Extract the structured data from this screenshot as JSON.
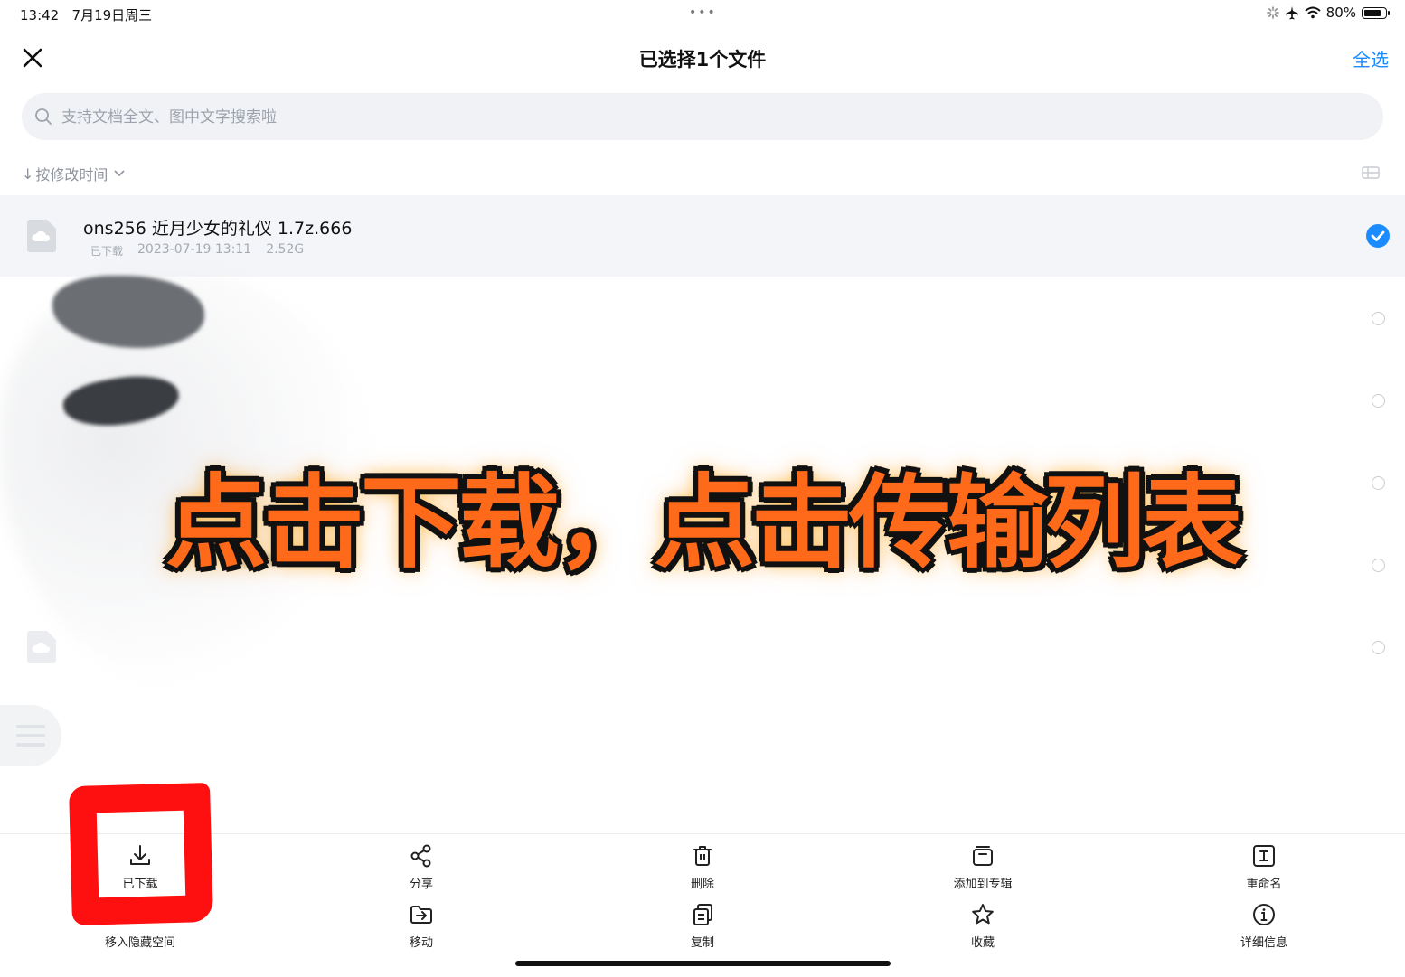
{
  "status_bar": {
    "time": "13:42",
    "date": "7月19日周三",
    "dots": "•••",
    "battery": "80%"
  },
  "header": {
    "title": "已选择1个文件",
    "select_all": "全选"
  },
  "search": {
    "placeholder": "支持文档全文、图中文字搜索啦"
  },
  "sort": {
    "label": "按修改时间"
  },
  "files": [
    {
      "name": "ons256 近月少女的礼仪 1.7z.666",
      "status": "已下载",
      "modified": "2023-07-19 13:11",
      "size": "2.52G",
      "selected": true
    },
    {
      "selected": false
    },
    {
      "selected": false
    },
    {
      "selected": false
    },
    {
      "selected": false
    },
    {
      "selected": false
    }
  ],
  "overlay_caption": "点击下载，点击传输列表",
  "toolbar": {
    "downloaded": "已下载",
    "share": "分享",
    "delete": "删除",
    "add_to_album": "添加到专辑",
    "rename": "重命名",
    "move_to_hidden": "移入隐藏空间",
    "move": "移动",
    "copy": "复制",
    "favorite": "收藏",
    "details": "详细信息"
  },
  "colors": {
    "accent": "#1a8cff",
    "highlight_box": "#ff1010",
    "caption_fill": "#ff6a1a"
  }
}
